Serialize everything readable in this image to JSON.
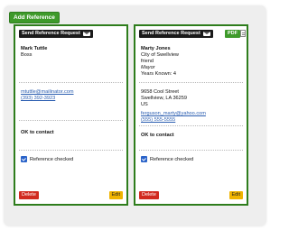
{
  "add_button_label": "Add Reference",
  "cards": [
    {
      "send_label": "Send Reference Request",
      "name": "Mark Tuttle",
      "relationship": "Boss",
      "email": "mtuttle@mailinator.com",
      "phone": "(393) 392-3923",
      "contact_status": "OK to contact",
      "checkbox_label": "Reference checked",
      "delete_label": "Delete",
      "edit_label": "Edit"
    },
    {
      "send_label": "Send Reference Request",
      "pdf_label": "PDF",
      "name": "Marty Jones",
      "org": "City of Swellview",
      "relationship": "friend",
      "title": "Mayor",
      "years_known": "Years Known: 4",
      "street": "9658 Cool Street",
      "city_state_zip": "Swellview, LA 36259",
      "country": "US",
      "email": "ferguson_marty@yahoo.com",
      "phone": "(555) 555-5555",
      "contact_status": "OK to contact",
      "checkbox_label": "Reference checked",
      "delete_label": "Delete",
      "edit_label": "Edit"
    }
  ]
}
